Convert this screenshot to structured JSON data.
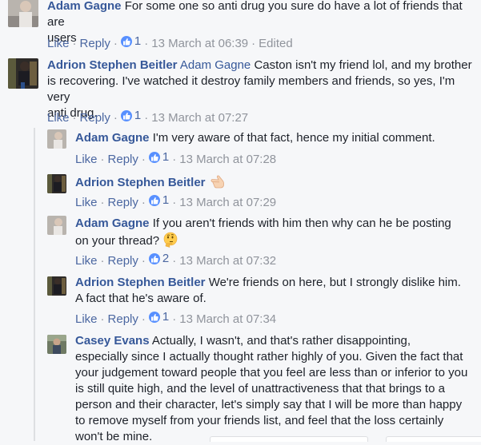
{
  "comments": [
    {
      "author": "Adam Gagne",
      "mention": "",
      "text_line1": "For some one so anti drug you sure do have a lot of friends that are",
      "text_line2": "users",
      "text_line3": "",
      "like": "Like",
      "reply": "Reply",
      "reactions": "1",
      "timestamp": "13 March at 06:39",
      "edited": "Edited"
    },
    {
      "author": "Adrion Stephen Beitler",
      "mention": "Adam Gagne",
      "text_line1": "Caston isn't my friend lol, and my brother",
      "text_line2": "is recovering. I've watched it destroy family members and friends, so yes, I'm very",
      "text_line3": "anti drug.",
      "like": "Like",
      "reply": "Reply",
      "reactions": "1",
      "timestamp": "13 March at 07:27"
    }
  ],
  "replies": [
    {
      "author": "Adam Gagne",
      "text_line1": "I'm very aware of that fact, hence my initial comment.",
      "like": "Like",
      "reply": "Reply",
      "reactions": "1",
      "timestamp": "13 March at 07:28"
    },
    {
      "author": "Adrion Stephen Beitler",
      "text_line1": "",
      "emoji": "backhand-index-pointing-left",
      "like": "Like",
      "reply": "Reply",
      "reactions": "1",
      "timestamp": "13 March at 07:29"
    },
    {
      "author": "Adam Gagne",
      "text_line1": "If you aren't friends with him then why can he be posting",
      "text_line2": "on your thread?",
      "emoji": "thinking-face",
      "like": "Like",
      "reply": "Reply",
      "reactions": "2",
      "timestamp": "13 March at 07:32"
    },
    {
      "author": "Adrion Stephen Beitler",
      "text_line1": "We're friends on here, but I strongly dislike him.",
      "text_line2": "A fact that he's aware of.",
      "like": "Like",
      "reply": "Reply",
      "reactions": "1",
      "timestamp": "13 March at 07:34"
    },
    {
      "author": "Casey Evans",
      "text_line1": "Actually, I wasn't, and that's rather disappointing,",
      "text_line2": "especially since I actually thought rather highly of you. Given the fact that",
      "text_line3": "your judgement toward people that you feel are less than or inferior to you",
      "text_line4": "is still quite high, and the level of unattractiveness that that brings to a",
      "text_line5": "person and their character, let's simply say that I will be more than happy",
      "text_line6": "to remove myself from your friends list, and feel that the loss certainly",
      "text_line7": "won't be mine."
    }
  ],
  "colors": {
    "link": "#365899",
    "action_link": "#4b67a1",
    "meta": "#90949c",
    "like_blue": "#5890ff",
    "background": "#f6f7f9"
  }
}
